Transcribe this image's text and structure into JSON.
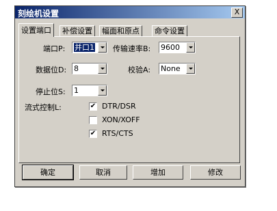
{
  "window": {
    "title": "刻绘机设置",
    "close_glyph": "X"
  },
  "tabs": [
    {
      "label": "设置端口",
      "active": true
    },
    {
      "label": "补偿设置",
      "active": false
    },
    {
      "label": "幅面和原点",
      "active": false
    },
    {
      "label": "命令设置",
      "active": false
    }
  ],
  "fields": {
    "port": {
      "label": "端口P:",
      "value": "并口1"
    },
    "baud": {
      "label": "传输速率B:",
      "value": "9600"
    },
    "databits": {
      "label": "数据位D:",
      "value": "8"
    },
    "parity": {
      "label": "校验A:",
      "value": "None"
    },
    "stopbits": {
      "label": "停止位S:",
      "value": "1"
    }
  },
  "flow_control": {
    "label": "流式控制L:",
    "options": [
      {
        "label": "DTR/DSR",
        "checked": true
      },
      {
        "label": "XON/XOFF",
        "checked": false
      },
      {
        "label": "RTS/CTS",
        "checked": true
      }
    ]
  },
  "buttons": {
    "ok": "确定",
    "cancel": "取消",
    "add": "增加",
    "modify": "修改"
  }
}
